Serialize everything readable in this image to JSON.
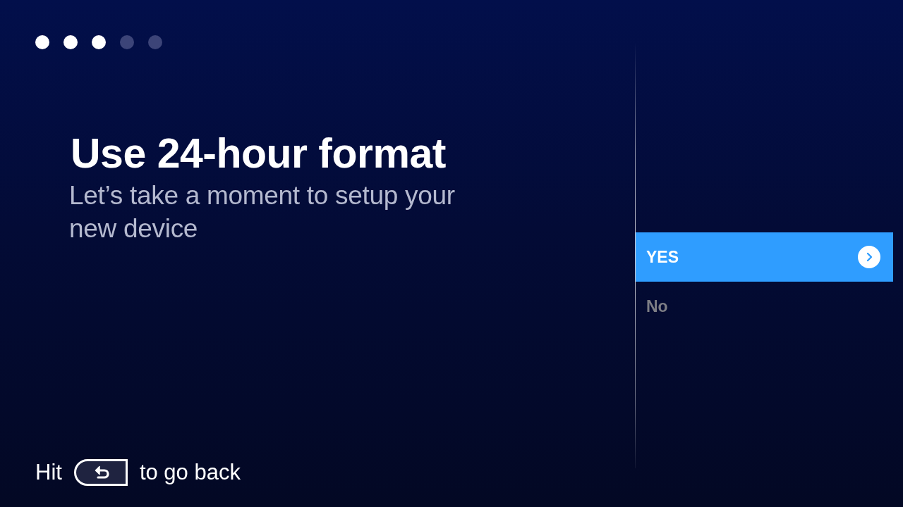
{
  "progress_steps": [
    {
      "completed": true
    },
    {
      "completed": true
    },
    {
      "completed": true
    },
    {
      "completed": false
    },
    {
      "completed": false
    }
  ],
  "title": "Use 24-hour format",
  "subtitle": "Let’s take a moment to setup your new device",
  "options": [
    {
      "label": "YES",
      "selected": true
    },
    {
      "label": "No",
      "selected": false
    }
  ],
  "hint": {
    "before": "Hit",
    "after": "to go back"
  }
}
